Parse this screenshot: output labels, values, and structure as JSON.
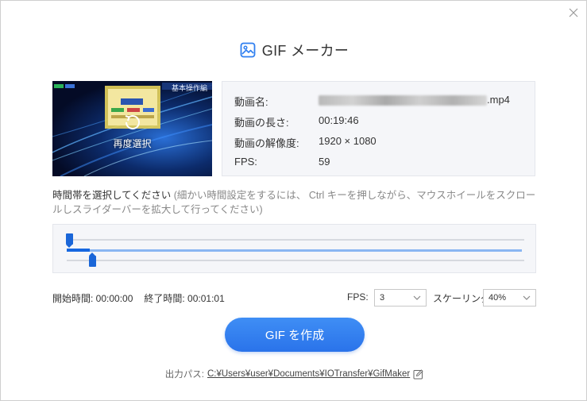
{
  "window": {
    "title": "GIF メーカー"
  },
  "thumbnail": {
    "banner": "基本操作編",
    "rechoose_label": "再度選択"
  },
  "info": {
    "name_label": "動画名:",
    "name_ext": ".mp4",
    "duration_label": "動画の長さ:",
    "duration_value": "00:19:46",
    "resolution_label": "動画の解像度:",
    "resolution_value": "1920 × 1080",
    "fps_label": "FPS:",
    "fps_value": "59"
  },
  "hint": {
    "strong": "時間帯を選択してください",
    "detail": "(細かい時間設定をするには、 Ctrl キーを押しながら、マウスホイールをスクロールしスライダーバーを拡大して行ってください)"
  },
  "timeline": {
    "start_fraction": 0.0,
    "end_fraction": 0.051
  },
  "times": {
    "start": "開始時間: 00:00:00",
    "end": "終了時間: 00:01:01"
  },
  "settings": {
    "fps_label": "FPS:",
    "fps_selected": "3",
    "scale_label": "スケーリング:",
    "scale_selected": "40%"
  },
  "actions": {
    "create_label": "GIF を作成"
  },
  "output": {
    "label": "出力パス:",
    "path": "C:¥Users¥user¥Documents¥IOTransfer¥GifMaker"
  },
  "colors": {
    "accent": "#2a73ea",
    "handle": "#1a66d8"
  }
}
